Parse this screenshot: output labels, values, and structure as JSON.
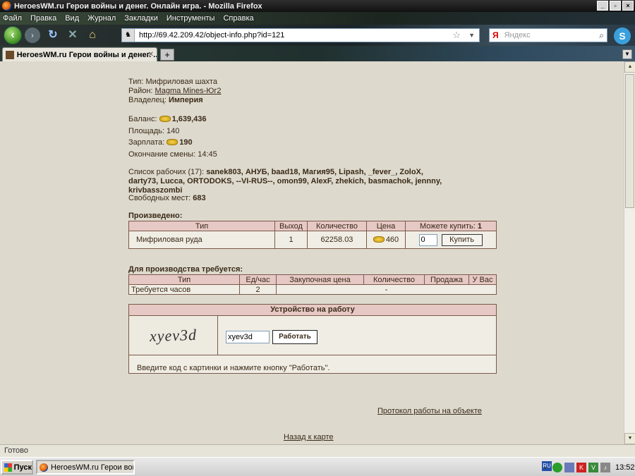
{
  "window": {
    "title": "HeroesWM.ru Герои войны и денег. Онлайн игра. - Mozilla Firefox",
    "min": "_",
    "max": "▫",
    "close": "×"
  },
  "menu": [
    "Файл",
    "Правка",
    "Вид",
    "Журнал",
    "Закладки",
    "Инструменты",
    "Справка"
  ],
  "nav": {
    "url": "http://69.42.209.42/object-info.php?id=121",
    "search_engine": "Я",
    "search_placeholder": "Яндекс"
  },
  "tab": {
    "title": "HeroesWM.ru Герои войны и денег. ...",
    "new_tab": "+"
  },
  "object": {
    "type_label": "Тип:",
    "type_value": "Мифриловая шахта",
    "district_label": "Район:",
    "district_value": "Magma Mines-Юг2",
    "owner_label": "Владелец:",
    "owner_value": "Империя",
    "balance_label": "Баланс:",
    "balance_value": "1,639,436",
    "area_label": "Площадь:",
    "area_value": "140",
    "salary_label": "Зарплата:",
    "salary_value": "190",
    "shift_end_label": "Окончание смены:",
    "shift_end_value": "14:45",
    "workers_label": "Список рабочих (17):",
    "workers_line1": "sanek803, АНУБ, baad18, Магия95, Lipash, _fever_, ZoloX,",
    "workers_line2": "darty73, Lucca, ORTODOKS, --VI-RUS--, omon99, AlexF, zhekich, basmachok, jennny,",
    "workers_line3": "krivbasszombi",
    "free_places_label": "Свободных мест:",
    "free_places_value": "683"
  },
  "produced": {
    "heading": "Произведено:",
    "columns": [
      "Тип",
      "Выход",
      "Количество",
      "Цена",
      "Можете купить:"
    ],
    "can_buy_value": "1",
    "row": {
      "type": "Мифриловая руда",
      "output": "1",
      "quantity": "62258.03",
      "price": "460",
      "qty_input": "0",
      "buy_button": "Купить"
    }
  },
  "required": {
    "heading": "Для производства требуется:",
    "columns": [
      "Тип",
      "Ед/час",
      "Закупочная цена",
      "Количество",
      "Продажа",
      "У Вас"
    ],
    "row": {
      "type": "Требуется часов",
      "per_hour": "2",
      "dash": "-"
    }
  },
  "work": {
    "heading": "Устройство на работу",
    "captcha_text": "xyev3d",
    "code_input": "xyev3d",
    "button": "Работать",
    "hint": "Введите код с картинки и нажмите кнопку \"Работать\"."
  },
  "links": {
    "protocol": "Протокол работы на объекте",
    "back_to_map": "Назад к карте"
  },
  "status": "Готово",
  "taskbar": {
    "start": "Пуск",
    "item": "HeroesWM.ru Герои вой...",
    "lang": "RU",
    "clock": "13:52"
  }
}
